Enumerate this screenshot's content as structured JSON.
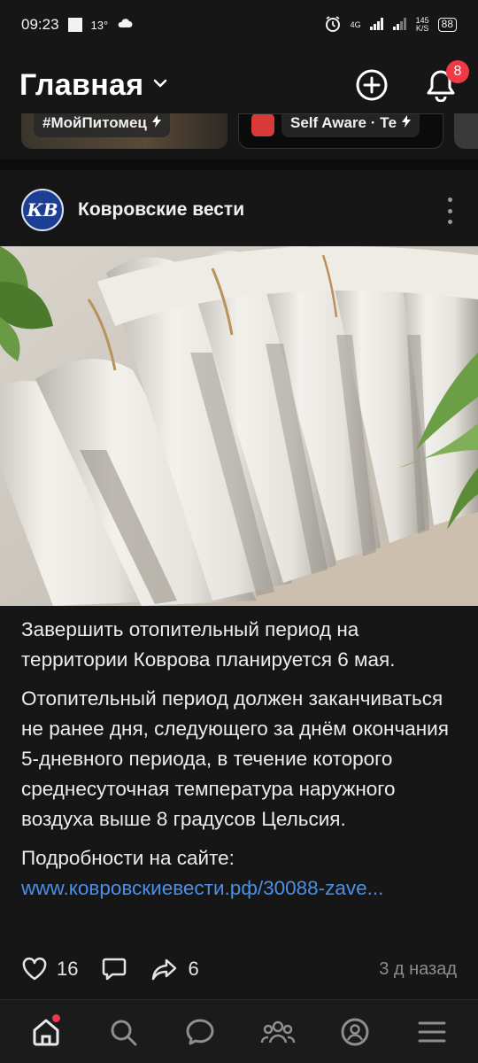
{
  "status_bar": {
    "time": "09:23",
    "temperature": "13°",
    "network": "4G",
    "speed_value": "145",
    "speed_unit": "K/S",
    "battery": "88"
  },
  "header": {
    "title": "Главная",
    "notifications_count": "8"
  },
  "stories": [
    {
      "label": "#МойПитомец",
      "icon": "lightning-icon"
    },
    {
      "label": "Self Aware · Те",
      "icon": "lightning-icon"
    }
  ],
  "post": {
    "author": "Ковровские вести",
    "avatar_text": "КВ",
    "image_alt_icon": "radiator-photo",
    "paragraphs": [
      "Завершить отопительный период на территории Коврова планируется 6 мая.",
      "Отопительный период должен заканчиваться не ранее дня, следующего за днём окончания 5-дневного периода, в течение которого среднесуточная температура наружного воздуха выше 8 градусов Цельсия.",
      "Подробности на сайте:"
    ],
    "link": "www.ковровскиевести.рф/30088-zave...",
    "likes": "16",
    "shares": "6",
    "timestamp": "3 д назад"
  },
  "bottom_nav": [
    {
      "name": "home",
      "icon": "home-icon",
      "has_dot": true
    },
    {
      "name": "search",
      "icon": "search-icon"
    },
    {
      "name": "messages",
      "icon": "chat-icon"
    },
    {
      "name": "friends",
      "icon": "people-icon"
    },
    {
      "name": "profile",
      "icon": "profile-icon"
    },
    {
      "name": "menu",
      "icon": "menu-icon"
    }
  ],
  "colors": {
    "background": "#161616",
    "accent_red": "#ef3a45",
    "link_blue": "#4a8fe8"
  }
}
